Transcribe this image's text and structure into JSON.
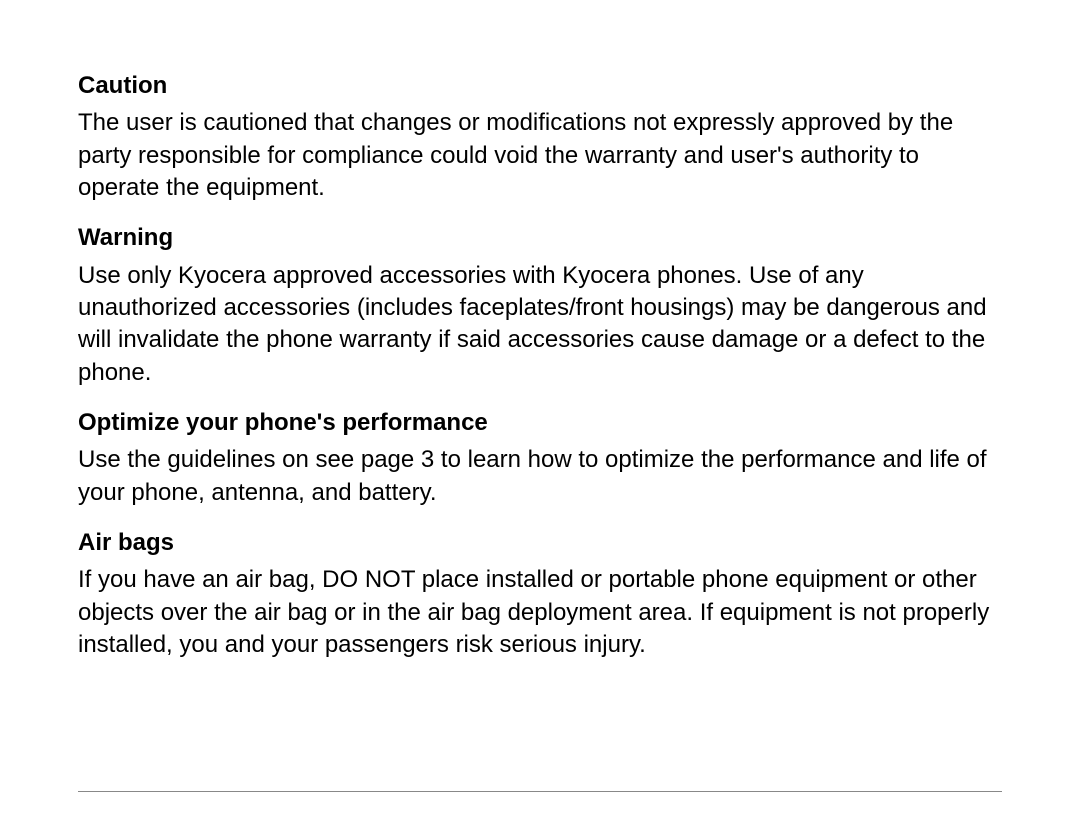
{
  "sections": [
    {
      "heading": "Caution",
      "body": "The user is cautioned that changes or modifications not expressly approved by the party responsible for compliance could void the warranty and user's authority to operate the equipment."
    },
    {
      "heading": "Warning",
      "body": "Use only Kyocera approved accessories with Kyocera phones. Use of any unauthorized accessories (includes faceplates/front housings) may be dangerous and will invalidate the phone warranty if said accessories cause damage or a defect to the phone."
    },
    {
      "heading": "Optimize your phone's performance",
      "body": "Use the guidelines on see page 3 to learn how to optimize the performance and life of your phone, antenna, and battery."
    },
    {
      "heading": "Air bags",
      "body": "If you have an air bag, DO NOT place installed or portable phone equipment or other objects over the air bag or in the air bag deployment area. If equipment is not properly installed, you and your passengers risk serious injury."
    }
  ]
}
